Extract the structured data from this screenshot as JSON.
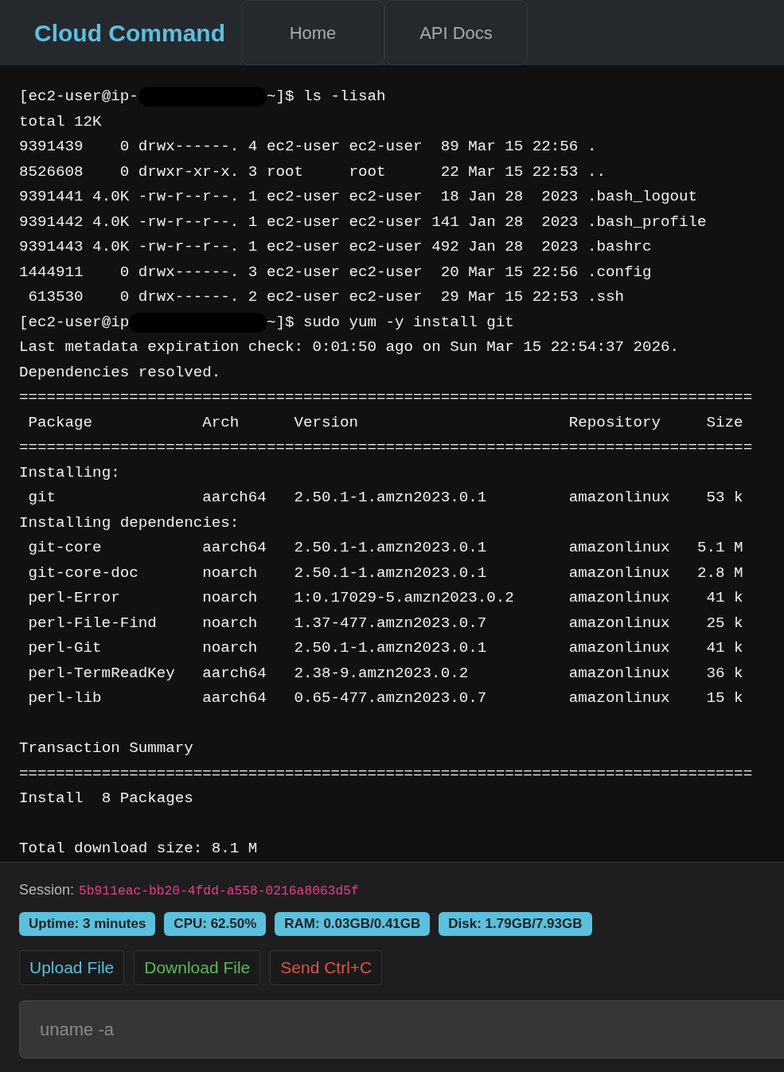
{
  "header": {
    "logo": "Cloud Command",
    "tabs": [
      {
        "label": "Home",
        "selected": false
      },
      {
        "label": "API Docs",
        "selected": false
      }
    ]
  },
  "terminal": {
    "lines": [
      {
        "kind": "prompt",
        "text_before": "[ec2-user@ip-",
        "redacted": true,
        "text_after": "~]$ ls -lisah"
      },
      {
        "kind": "output",
        "text": "total 12K"
      },
      {
        "kind": "output",
        "text": "9391439    0 drwx------. 4 ec2-user ec2-user  89 Mar 15 22:56 ."
      },
      {
        "kind": "output",
        "text": "8526608    0 drwxr-xr-x. 3 root     root      22 Mar 15 22:53 .."
      },
      {
        "kind": "output",
        "text": "9391441 4.0K -rw-r--r--. 1 ec2-user ec2-user  18 Jan 28  2023 .bash_logout"
      },
      {
        "kind": "output",
        "text": "9391442 4.0K -rw-r--r--. 1 ec2-user ec2-user 141 Jan 28  2023 .bash_profile"
      },
      {
        "kind": "output",
        "text": "9391443 4.0K -rw-r--r--. 1 ec2-user ec2-user 492 Jan 28  2023 .bashrc"
      },
      {
        "kind": "output",
        "text": "1444911    0 drwx------. 3 ec2-user ec2-user  20 Mar 15 22:56 .config"
      },
      {
        "kind": "output",
        "text": " 613530    0 drwx------. 2 ec2-user ec2-user  29 Mar 15 22:53 .ssh"
      },
      {
        "kind": "prompt",
        "text_before": "[ec2-user@ip",
        "redacted": true,
        "text_after": "~]$ sudo yum -y install git"
      },
      {
        "kind": "output",
        "text": "Last metadata expiration check: 0:01:50 ago on Sun Mar 15 22:54:37 2026."
      },
      {
        "kind": "output",
        "text": "Dependencies resolved."
      },
      {
        "kind": "separator",
        "text": "================================================================================"
      },
      {
        "kind": "table_header",
        "cells": [
          "Package",
          "Arch",
          "Version",
          "Repository",
          "Size"
        ]
      },
      {
        "kind": "separator",
        "text": "================================================================================"
      },
      {
        "kind": "output",
        "text": "Installing:"
      },
      {
        "kind": "package_row",
        "cells": [
          "git",
          "aarch64",
          "2.50.1-1.amzn2023.0.1",
          "amazonlinux",
          "53 k"
        ]
      },
      {
        "kind": "output",
        "text": "Installing dependencies:"
      },
      {
        "kind": "package_row",
        "cells": [
          "git-core",
          "aarch64",
          "2.50.1-1.amzn2023.0.1",
          "amazonlinux",
          "5.1 M"
        ]
      },
      {
        "kind": "package_row",
        "cells": [
          "git-core-doc",
          "noarch",
          "2.50.1-1.amzn2023.0.1",
          "amazonlinux",
          "2.8 M"
        ]
      },
      {
        "kind": "package_row",
        "cells": [
          "perl-Error",
          "noarch",
          "1:0.17029-5.amzn2023.0.2",
          "amazonlinux",
          "41 k"
        ]
      },
      {
        "kind": "package_row",
        "cells": [
          "perl-File-Find",
          "noarch",
          "1.37-477.amzn2023.0.7",
          "amazonlinux",
          "25 k"
        ]
      },
      {
        "kind": "package_row",
        "cells": [
          "perl-Git",
          "noarch",
          "2.50.1-1.amzn2023.0.1",
          "amazonlinux",
          "41 k"
        ]
      },
      {
        "kind": "package_row",
        "cells": [
          "perl-TermReadKey",
          "aarch64",
          "2.38-9.amzn2023.0.2",
          "amazonlinux",
          "36 k"
        ]
      },
      {
        "kind": "package_row",
        "cells": [
          "perl-lib",
          "aarch64",
          "0.65-477.amzn2023.0.7",
          "amazonlinux",
          "15 k"
        ]
      },
      {
        "kind": "blank"
      },
      {
        "kind": "output",
        "text": "Transaction Summary"
      },
      {
        "kind": "separator",
        "text": "================================================================================"
      },
      {
        "kind": "output",
        "text": "Install  8 Packages"
      },
      {
        "kind": "blank"
      },
      {
        "kind": "output",
        "text": "Total download size: 8.1 M"
      }
    ]
  },
  "session": {
    "label": "Session:",
    "id": "5b911eac-bb20-4fdd-a558-0216a8063d5f"
  },
  "stats": [
    "Uptime: 3 minutes",
    "CPU: 62.50%",
    "RAM: 0.03GB/0.41GB",
    "Disk: 1.79GB/7.93GB"
  ],
  "buttons": [
    {
      "label": "Upload File",
      "color": "#5bc0de"
    },
    {
      "label": "Download File",
      "color": "#5cb85c"
    },
    {
      "label": "Send Ctrl+C",
      "color": "#e0524c"
    }
  ],
  "command_input": {
    "placeholder": "uname -a"
  }
}
